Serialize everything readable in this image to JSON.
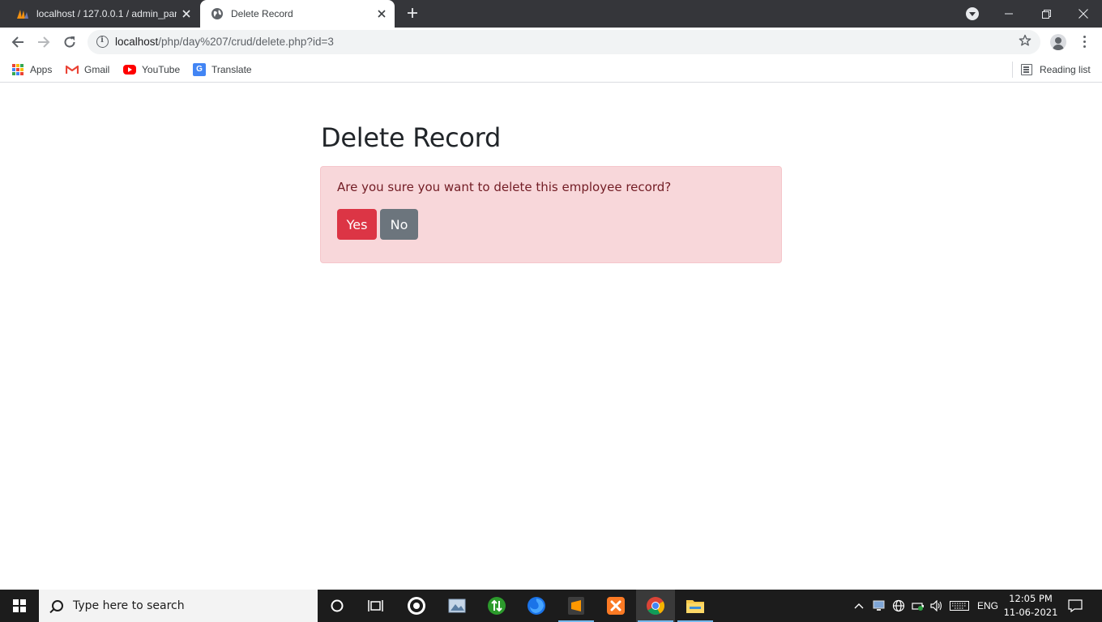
{
  "browser": {
    "tabs": [
      {
        "title": "localhost / 127.0.0.1 / admin_pan",
        "icon": "phpmyadmin-icon",
        "active": false
      },
      {
        "title": "Delete Record",
        "icon": "globe-icon",
        "active": true
      }
    ],
    "new_tab_icon": "plus-icon",
    "url_host": "localhost",
    "url_path": "/php/day%207/crud/delete.php?id=3",
    "bookmarks": [
      {
        "label": "Apps",
        "icon": "apps-grid-icon"
      },
      {
        "label": "Gmail",
        "icon": "gmail-icon"
      },
      {
        "label": "YouTube",
        "icon": "youtube-icon"
      },
      {
        "label": "Translate",
        "icon": "translate-icon"
      }
    ],
    "reading_list": "Reading list"
  },
  "page": {
    "title": "Delete Record",
    "alert_text": "Are you sure you want to delete this employee record?",
    "yes_label": "Yes",
    "no_label": "No",
    "colors": {
      "danger": "#dc3545",
      "secondary": "#6c757d",
      "alert_bg": "#f8d7da",
      "alert_text": "#721c24"
    }
  },
  "taskbar": {
    "search_placeholder": "Type here to search",
    "language": "ENG",
    "time": "12:05 PM",
    "date": "11-06-2021",
    "apps": [
      "cortana-icon",
      "task-view-icon",
      "obs-icon",
      "photos-icon",
      "torrent-icon",
      "firefox-icon",
      "sublime-text-icon",
      "xampp-icon",
      "chrome-icon",
      "file-explorer-icon"
    ]
  }
}
